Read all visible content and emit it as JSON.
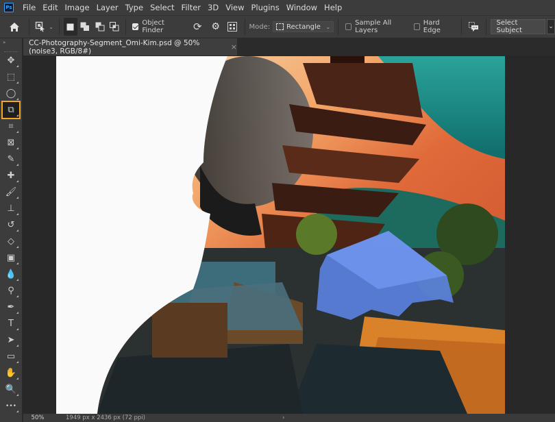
{
  "app": {
    "logo": "Ps"
  },
  "menu": [
    "File",
    "Edit",
    "Image",
    "Layer",
    "Type",
    "Select",
    "Filter",
    "3D",
    "View",
    "Plugins",
    "Window",
    "Help"
  ],
  "options": {
    "object_finder_label": "Object Finder",
    "object_finder_checked": true,
    "mode_label": "Mode:",
    "mode_value": "Rectangle",
    "sample_all_layers_label": "Sample All Layers",
    "sample_all_layers_checked": false,
    "hard_edge_label": "Hard Edge",
    "hard_edge_checked": false,
    "select_subject_label": "Select Subject"
  },
  "document": {
    "tab_title": "CC-Photography-Segment_Omi-Kim.psd @ 50% (noise3, RGB/8#)",
    "close_glyph": "×"
  },
  "tools": [
    {
      "name": "move-tool",
      "glyph": "✥"
    },
    {
      "name": "rectangular-marquee-tool",
      "glyph": "⬚"
    },
    {
      "name": "lasso-tool",
      "glyph": "◯"
    },
    {
      "name": "object-selection-tool",
      "glyph": "⧉",
      "active": true
    },
    {
      "name": "crop-tool",
      "glyph": "⌗"
    },
    {
      "name": "frame-tool",
      "glyph": "⊠"
    },
    {
      "name": "eyedropper-tool",
      "glyph": "✎"
    },
    {
      "name": "spot-healing-brush-tool",
      "glyph": "✚"
    },
    {
      "name": "brush-tool",
      "glyph": "🖌"
    },
    {
      "name": "clone-stamp-tool",
      "glyph": "⊥"
    },
    {
      "name": "history-brush-tool",
      "glyph": "↺"
    },
    {
      "name": "eraser-tool",
      "glyph": "◇"
    },
    {
      "name": "gradient-tool",
      "glyph": "▣"
    },
    {
      "name": "blur-tool",
      "glyph": "💧"
    },
    {
      "name": "dodge-tool",
      "glyph": "⚲"
    },
    {
      "name": "pen-tool",
      "glyph": "✒"
    },
    {
      "name": "type-tool",
      "glyph": "T"
    },
    {
      "name": "path-selection-tool",
      "glyph": "➤"
    },
    {
      "name": "rectangle-tool",
      "glyph": "▭"
    },
    {
      "name": "hand-tool",
      "glyph": "✋"
    },
    {
      "name": "zoom-tool",
      "glyph": "🔍"
    },
    {
      "name": "edit-toolbar",
      "glyph": "•••"
    }
  ],
  "status": {
    "zoom": "50%",
    "doc_info": "1949 px x 2436 px (72 ppi)",
    "arrow": "›"
  }
}
